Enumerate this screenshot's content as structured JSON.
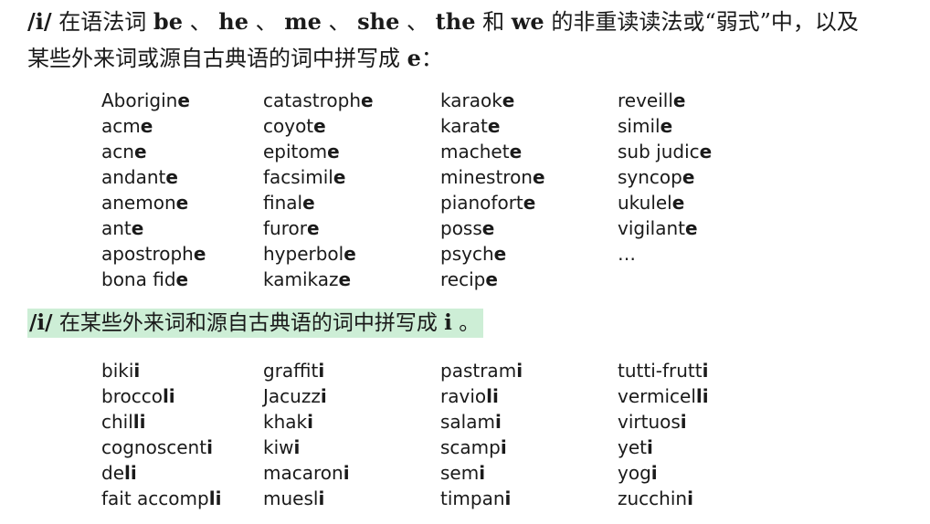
{
  "intro": {
    "ipa": "/i/",
    "t1": " 在语法词 ",
    "w1": "be",
    "s1": " 、 ",
    "w2": "he",
    "s2": " 、 ",
    "w3": "me",
    "s3": " 、 ",
    "w4": "she",
    "s4": " 、 ",
    "w5": "the",
    "t2": " 和 ",
    "w6": "we",
    "t3": " 的非重读读法或“弱式”中，以及",
    "t4": "某些外来词或源自古典语的词中拼写成 ",
    "letter": "e",
    "t5": "："
  },
  "words_e": [
    [
      "Aborigin",
      "e",
      "catastroph",
      "e",
      "karaok",
      "e",
      "reveill",
      "e"
    ],
    [
      "acm",
      "e",
      "coyot",
      "e",
      "karat",
      "e",
      "simil",
      "e"
    ],
    [
      "acn",
      "e",
      "epitom",
      "e",
      "machet",
      "e",
      "sub judic",
      "e"
    ],
    [
      "andant",
      "e",
      "facsimil",
      "e",
      "minestron",
      "e",
      "syncop",
      "e"
    ],
    [
      "anemon",
      "e",
      "final",
      "e",
      "pianofort",
      "e",
      "ukulel",
      "e"
    ],
    [
      "ant",
      "e",
      "furor",
      "e",
      "poss",
      "e",
      "vigilant",
      "e"
    ],
    [
      "apostroph",
      "e",
      "hyperbol",
      "e",
      "psych",
      "e",
      "…",
      ""
    ],
    [
      "bona fid",
      "e",
      "kamikaz",
      "e",
      "recip",
      "e",
      "",
      ""
    ]
  ],
  "heading_i": {
    "ipa": "/i/",
    "text": " 在某些外来词和源自古典语的词中拼写成 ",
    "letter": "i",
    "end": " 。"
  },
  "words_i": [
    [
      "biki",
      "i",
      "graffit",
      "i",
      "pastram",
      "i",
      "tutti-frutt",
      "i"
    ],
    [
      "brocco",
      "li",
      "Jacuzz",
      "i",
      "ravio",
      "li",
      "vermicel",
      "li"
    ],
    [
      "chil",
      "li",
      "khak",
      "i",
      "salam",
      "i",
      "virtuos",
      "i"
    ],
    [
      "cognoscent",
      "i",
      "kiw",
      "i",
      "scamp",
      "i",
      "yet",
      "i"
    ],
    [
      "de",
      "li",
      "macaron",
      "i",
      "sem",
      "i",
      "yog",
      "i"
    ],
    [
      "fait accomp",
      "li",
      "muesl",
      "i",
      "timpan",
      "i",
      "zucchin",
      "i"
    ]
  ]
}
